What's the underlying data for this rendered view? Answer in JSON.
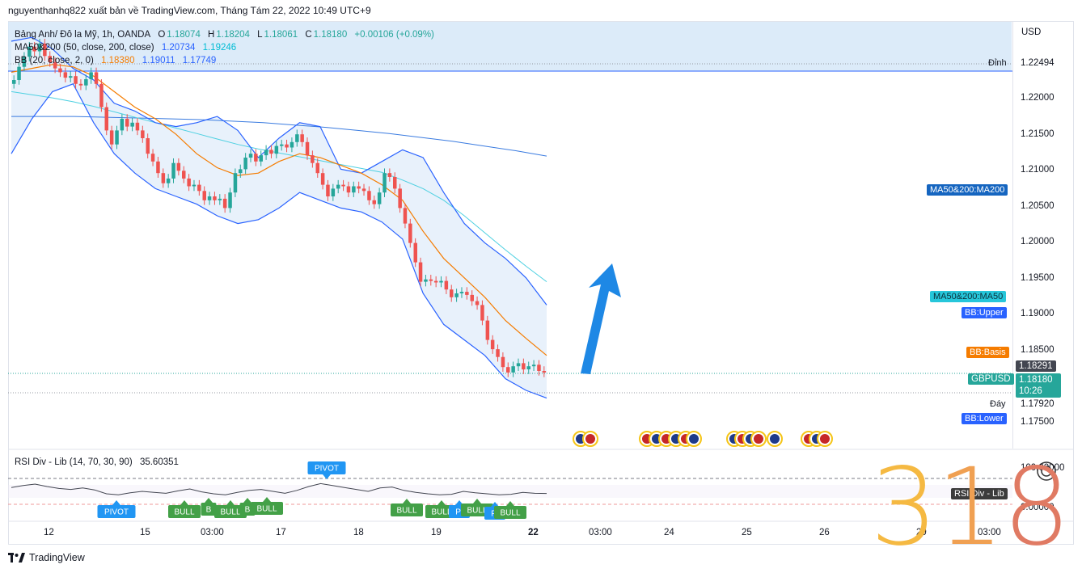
{
  "header": "nguyenthanhq822 xuất bản về TradingView.com, Tháng Tám 22, 2022 10:49 UTC+9",
  "legend": {
    "symbol_line": "Bảng Anh/ Đô la Mỹ, 1h, OANDA",
    "o_label": "O",
    "o_value": "1.18074",
    "h_label": "H",
    "h_value": "1.18204",
    "l_label": "L",
    "l_value": "1.18061",
    "c_label": "C",
    "c_value": "1.18180",
    "change": "+0.00106 (+0.09%)",
    "ma_line": "MA50&200 (50, close, 200, close)",
    "ma50_value": "1.20734",
    "ma200_value": "1.19246",
    "bb_line": "BB (20, close, 2, 0)",
    "bb_basis": "1.18380",
    "bb_upper": "1.19011",
    "bb_lower": "1.17749"
  },
  "price_axis": {
    "currency": "USD",
    "ticks": [
      "1.22000",
      "1.21500",
      "1.21000",
      "1.20500",
      "1.20000",
      "1.19500",
      "1.19000",
      "1.18500",
      "1.17500"
    ],
    "high_label": "Đỉnh",
    "high_value": "1.22494",
    "low_label": "Đáy",
    "low_value": "1.17920",
    "tags": {
      "ma200": "MA50&200:MA200",
      "ma50": "MA50&200:MA50",
      "bb_upper": "BB:Upper",
      "bb_basis": "BB:Basis",
      "bb_lower": "BB:Lower",
      "crosshair": "1.18291",
      "symbol": "GBPUSD",
      "last": "1.18180",
      "countdown": "10:26"
    }
  },
  "time_axis": [
    "12",
    "15",
    "03:00",
    "17",
    "18",
    "19",
    "22",
    "03:00",
    "24",
    "25",
    "26",
    "29",
    "03:00"
  ],
  "rsi": {
    "legend": "RSI Div - Lib (14, 70, 30, 90)",
    "value": "35.60351",
    "axis_top": "100.00000",
    "axis_bottom": "0.00000",
    "tag": "RSI Div - Lib",
    "pivot_label": "PIVOT",
    "bull_label": "BULL",
    "bull_short": "BU",
    "bull_tiny": "B",
    "pivot_short": "PI"
  },
  "watermark": "318",
  "footer": "TradingView",
  "colors": {
    "up": "#26a69a",
    "down": "#ef5350",
    "ma50": "#4dd0e1",
    "ma200": "#3a7be0",
    "bb_line": "#2962ff",
    "bb_basis": "#f57c00",
    "bb_fill": "#e8f1fb",
    "arrow": "#1e88e5",
    "bull": "#43a047",
    "pivot": "#2196f3"
  },
  "chart_data": {
    "type": "candlestick",
    "symbol": "GBPUSD",
    "timeframe": "1h",
    "y_range": [
      1.172,
      1.227
    ],
    "x_labels": [
      "12",
      "15",
      "03:00",
      "17",
      "18",
      "19",
      "22",
      "03:00",
      "24",
      "25",
      "26",
      "29",
      "03:00"
    ],
    "close": [
      1.2195,
      1.2212,
      1.2225,
      1.2238,
      1.2232,
      1.2242,
      1.2226,
      1.2218,
      1.221,
      1.2205,
      1.2198,
      1.22,
      1.219,
      1.2188,
      1.2196,
      1.2205,
      1.219,
      1.216,
      1.213,
      1.2112,
      1.213,
      1.2145,
      1.2135,
      1.214,
      1.213,
      1.212,
      1.21,
      1.209,
      1.2075,
      1.2062,
      1.2068,
      1.2088,
      1.2078,
      1.2068,
      1.2058,
      1.206,
      1.2052,
      1.204,
      1.2045,
      1.204,
      1.2042,
      1.203,
      1.205,
      1.2075,
      1.208,
      1.2095,
      1.21,
      1.209,
      1.2098,
      1.2105,
      1.21,
      1.211,
      1.2112,
      1.2108,
      1.2115,
      1.2125,
      1.2115,
      1.2098,
      1.2088,
      1.2075,
      1.206,
      1.2045,
      1.2055,
      1.206,
      1.2058,
      1.205,
      1.2058,
      1.2055,
      1.2052,
      1.204,
      1.2035,
      1.205,
      1.2075,
      1.207,
      1.2055,
      1.203,
      1.201,
      1.1985,
      1.196,
      1.1935,
      1.1938,
      1.1936,
      1.1934,
      1.1936,
      1.1925,
      1.1915,
      1.192,
      1.1922,
      1.1918,
      1.191,
      1.1905,
      1.1885,
      1.186,
      1.1848,
      1.1838,
      1.1825,
      1.1818,
      1.1826,
      1.183,
      1.1822,
      1.1826,
      1.1828,
      1.182,
      1.1818
    ],
    "ma50": [
      1.218,
      1.2176,
      1.2172,
      1.2167,
      1.2161,
      1.2154,
      1.2147,
      1.214,
      1.2133,
      1.2126,
      1.2119,
      1.2112,
      1.2106,
      1.2101,
      1.2096,
      1.2091,
      1.2086,
      1.2081,
      1.2076,
      1.2066,
      1.2055,
      1.204,
      1.202,
      1.1998,
      1.1976,
      1.1955,
      1.1935
    ],
    "ma200": [
      1.2148,
      1.2148,
      1.2148,
      1.2147,
      1.2146,
      1.2145,
      1.2144,
      1.2142,
      1.214,
      1.2137,
      1.2134,
      1.213,
      1.2126,
      1.2121,
      1.2116,
      1.211,
      1.2104,
      1.2097
    ],
    "bb_basis": [
      1.2205,
      1.221,
      1.2215,
      1.2212,
      1.22,
      1.218,
      1.216,
      1.2145,
      1.2125,
      1.21,
      1.2082,
      1.2072,
      1.2075,
      1.209,
      1.21,
      1.2095,
      1.2085,
      1.2075,
      1.206,
      1.204,
      1.2,
      1.1965,
      1.194,
      1.1915,
      1.1885,
      1.1862,
      1.184
    ],
    "bb_upper": [
      1.2245,
      1.225,
      1.2235,
      1.221,
      1.2195,
      1.2165,
      1.2155,
      1.214,
      1.2135,
      1.214,
      1.2148,
      1.213,
      1.2095,
      1.212,
      1.214,
      1.2135,
      1.208,
      1.2075,
      1.209,
      1.2105,
      1.2095,
      1.205,
      1.201,
      1.1985,
      1.1965,
      1.194,
      1.1905
    ],
    "bb_lower": [
      1.21,
      1.2145,
      1.218,
      1.219,
      1.214,
      1.21,
      1.2075,
      1.2055,
      1.2045,
      1.2035,
      1.202,
      1.201,
      1.2015,
      1.203,
      1.205,
      1.204,
      1.203,
      1.2025,
      1.2012,
      1.199,
      1.192,
      1.188,
      1.186,
      1.184,
      1.181,
      1.1795,
      1.1785
    ],
    "rsi_series": [
      48,
      52,
      55,
      50,
      46,
      44,
      47,
      43,
      35,
      33,
      37,
      40,
      38,
      36,
      41,
      45,
      39,
      35,
      33,
      38,
      42,
      44,
      40,
      36,
      42,
      50,
      56,
      52,
      48,
      44,
      40,
      47,
      49,
      42,
      38,
      35,
      33,
      34,
      40,
      37,
      35,
      33,
      34,
      38,
      36,
      35.6
    ]
  }
}
